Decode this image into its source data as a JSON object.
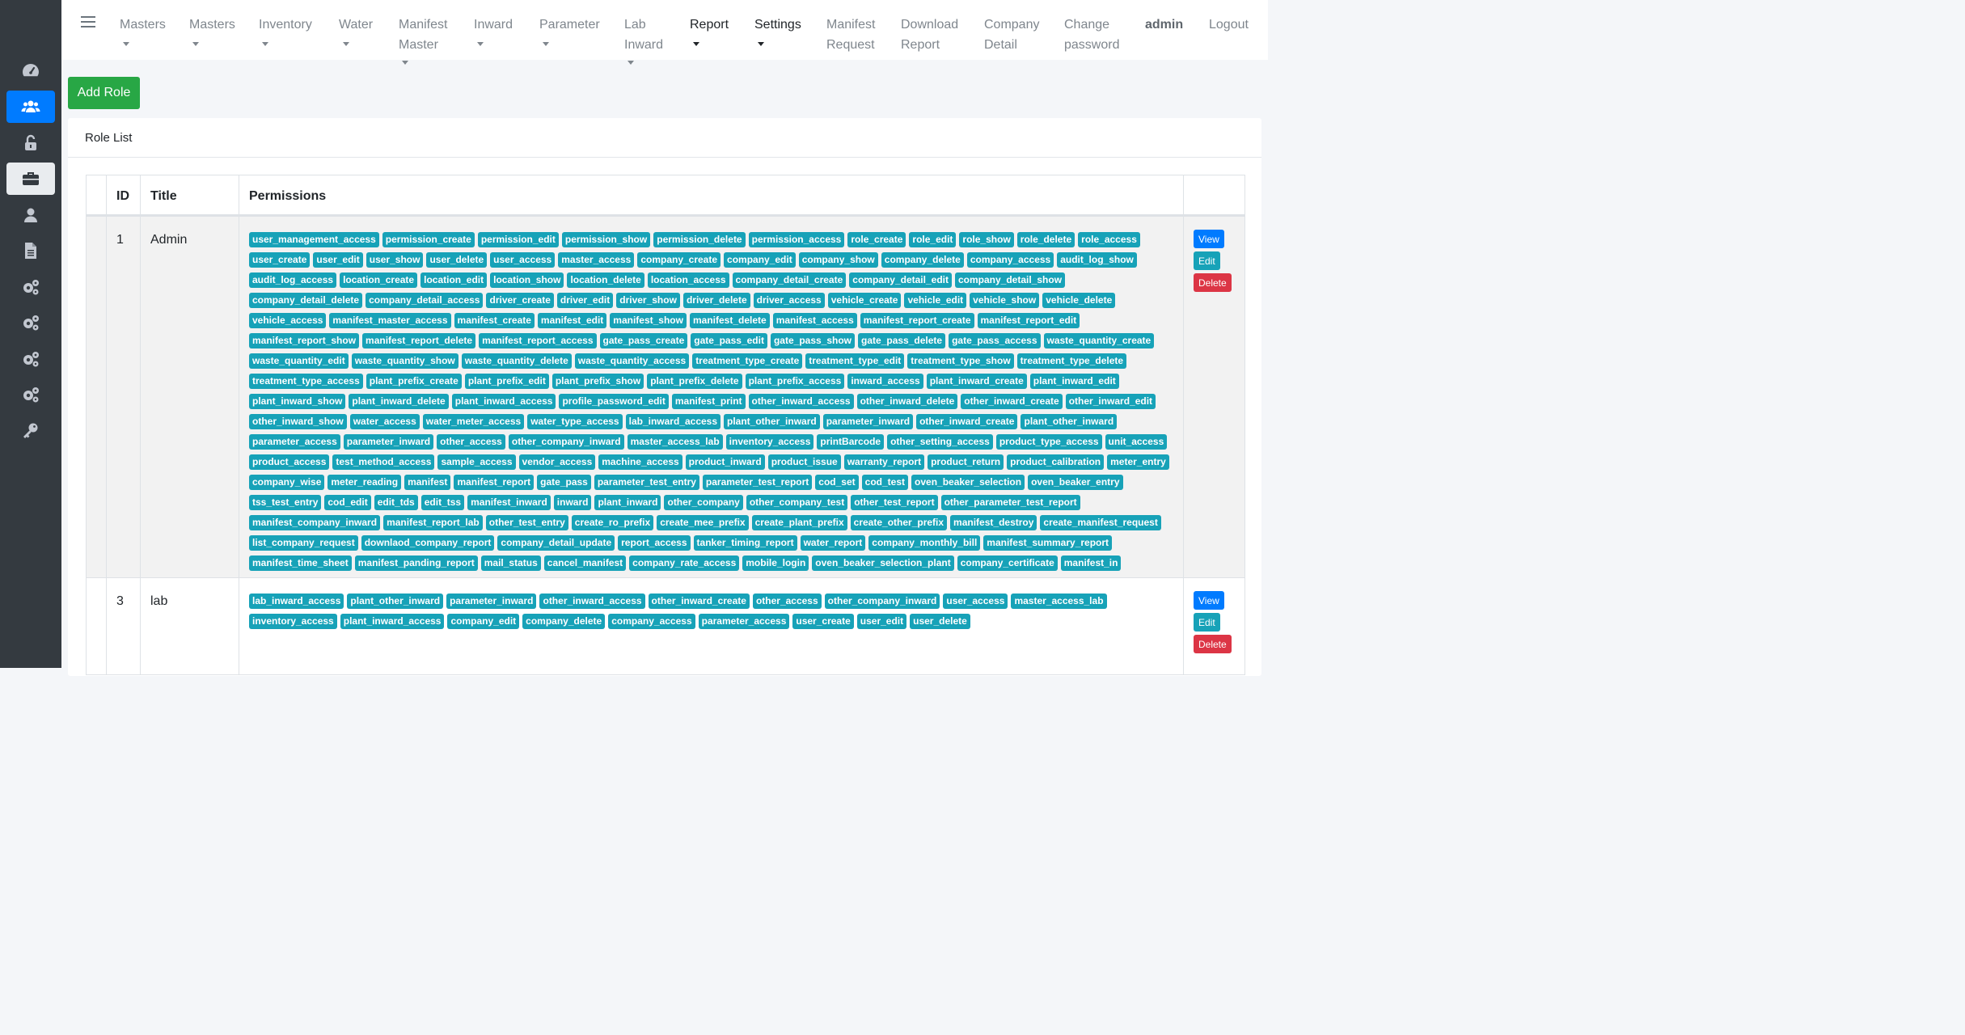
{
  "navbar": {
    "items": [
      {
        "label": "Masters",
        "caret": true
      },
      {
        "label": "Masters",
        "caret": true
      },
      {
        "label": "Inventory",
        "caret": true
      },
      {
        "label": "Water",
        "caret": true
      },
      {
        "label1": "Manifest",
        "label2": "Master",
        "caret": true
      },
      {
        "label": "Inward",
        "caret": true
      },
      {
        "label": "Parameter",
        "caret": true
      },
      {
        "label1": "Lab",
        "label2": "Inward",
        "caret": true
      },
      {
        "label": "Report",
        "caret": true
      },
      {
        "label": "Settings",
        "caret": true
      },
      {
        "label1": "Manifest",
        "label2": "Request"
      },
      {
        "label1": "Download",
        "label2": "Report"
      },
      {
        "label1": "Company",
        "label2": "Detail"
      },
      {
        "label1": "Change",
        "label2": "password"
      },
      {
        "label": "admin"
      },
      {
        "label": "Logout"
      }
    ]
  },
  "sidebar": {
    "icons": [
      "dashboard-icon",
      "users-icon",
      "unlock-icon",
      "briefcase-icon",
      "user-icon",
      "file-icon",
      "cogs-icon",
      "cogs-icon",
      "cogs-icon",
      "cogs-icon",
      "key-icon"
    ]
  },
  "add_role_label": "Add Role",
  "card_title": "Role List",
  "table": {
    "headers": {
      "id": "ID",
      "title": "Title",
      "permissions": "Permissions"
    },
    "actions": {
      "view": "View",
      "edit": "Edit",
      "delete": "Delete"
    },
    "rows": [
      {
        "id": "1",
        "title": "Admin",
        "permissions": [
          "user_management_access",
          "permission_create",
          "permission_edit",
          "permission_show",
          "permission_delete",
          "permission_access",
          "role_create",
          "role_edit",
          "role_show",
          "role_delete",
          "role_access",
          "user_create",
          "user_edit",
          "user_show",
          "user_delete",
          "user_access",
          "master_access",
          "company_create",
          "company_edit",
          "company_show",
          "company_delete",
          "company_access",
          "audit_log_show",
          "audit_log_access",
          "location_create",
          "location_edit",
          "location_show",
          "location_delete",
          "location_access",
          "company_detail_create",
          "company_detail_edit",
          "company_detail_show",
          "company_detail_delete",
          "company_detail_access",
          "driver_create",
          "driver_edit",
          "driver_show",
          "driver_delete",
          "driver_access",
          "vehicle_create",
          "vehicle_edit",
          "vehicle_show",
          "vehicle_delete",
          "vehicle_access",
          "manifest_master_access",
          "manifest_create",
          "manifest_edit",
          "manifest_show",
          "manifest_delete",
          "manifest_access",
          "manifest_report_create",
          "manifest_report_edit",
          "manifest_report_show",
          "manifest_report_delete",
          "manifest_report_access",
          "gate_pass_create",
          "gate_pass_edit",
          "gate_pass_show",
          "gate_pass_delete",
          "gate_pass_access",
          "waste_quantity_create",
          "waste_quantity_edit",
          "waste_quantity_show",
          "waste_quantity_delete",
          "waste_quantity_access",
          "treatment_type_create",
          "treatment_type_edit",
          "treatment_type_show",
          "treatment_type_delete",
          "treatment_type_access",
          "plant_prefix_create",
          "plant_prefix_edit",
          "plant_prefix_show",
          "plant_prefix_delete",
          "plant_prefix_access",
          "inward_access",
          "plant_inward_create",
          "plant_inward_edit",
          "plant_inward_show",
          "plant_inward_delete",
          "plant_inward_access",
          "profile_password_edit",
          "manifest_print",
          "other_inward_access",
          "other_inward_delete",
          "other_inward_create",
          "other_inward_edit",
          "other_inward_show",
          "water_access",
          "water_meter_access",
          "water_type_access",
          "lab_inward_access",
          "plant_other_inward",
          "parameter_inward",
          "other_inward_create",
          "plant_other_inward",
          "parameter_access",
          "parameter_inward",
          "other_access",
          "other_company_inward",
          "master_access_lab",
          "inventory_access",
          "printBarcode",
          "other_setting_access",
          "product_type_access",
          "unit_access",
          "product_access",
          "test_method_access",
          "sample_access",
          "vendor_access",
          "machine_access",
          "product_inward",
          "product_issue",
          "warranty_report",
          "product_return",
          "product_calibration",
          "meter_entry",
          "company_wise",
          "meter_reading",
          "manifest",
          "manifest_report",
          "gate_pass",
          "parameter_test_entry",
          "parameter_test_report",
          "cod_set",
          "cod_test",
          "oven_beaker_selection",
          "oven_beaker_entry",
          "tss_test_entry",
          "cod_edit",
          "edit_tds",
          "edit_tss",
          "manifest_inward",
          "inward",
          "plant_inward",
          "other_company",
          "other_company_test",
          "other_test_report",
          "other_parameter_test_report",
          "manifest_company_inward",
          "manifest_report_lab",
          "other_test_entry",
          "create_ro_prefix",
          "create_mee_prefix",
          "create_plant_prefix",
          "create_other_prefix",
          "manifest_destroy",
          "create_manifest_request",
          "list_company_request",
          "downlaod_company_report",
          "company_detail_update",
          "report_access",
          "tanker_timing_report",
          "water_report",
          "company_monthly_bill",
          "manifest_summary_report",
          "manifest_time_sheet",
          "manifest_panding_report",
          "mail_status",
          "cancel_manifest",
          "company_rate_access",
          "mobile_login",
          "oven_beaker_selection_plant",
          "company_certificate",
          "manifest_in"
        ]
      },
      {
        "id": "3",
        "title": "lab",
        "permissions": [
          "lab_inward_access",
          "plant_other_inward",
          "parameter_inward",
          "other_inward_access",
          "other_inward_create",
          "other_access",
          "other_company_inward",
          "user_access",
          "master_access_lab",
          "inventory_access",
          "plant_inward_access",
          "company_edit",
          "company_delete",
          "company_access",
          "parameter_access",
          "user_create",
          "user_edit",
          "user_delete"
        ]
      }
    ]
  }
}
